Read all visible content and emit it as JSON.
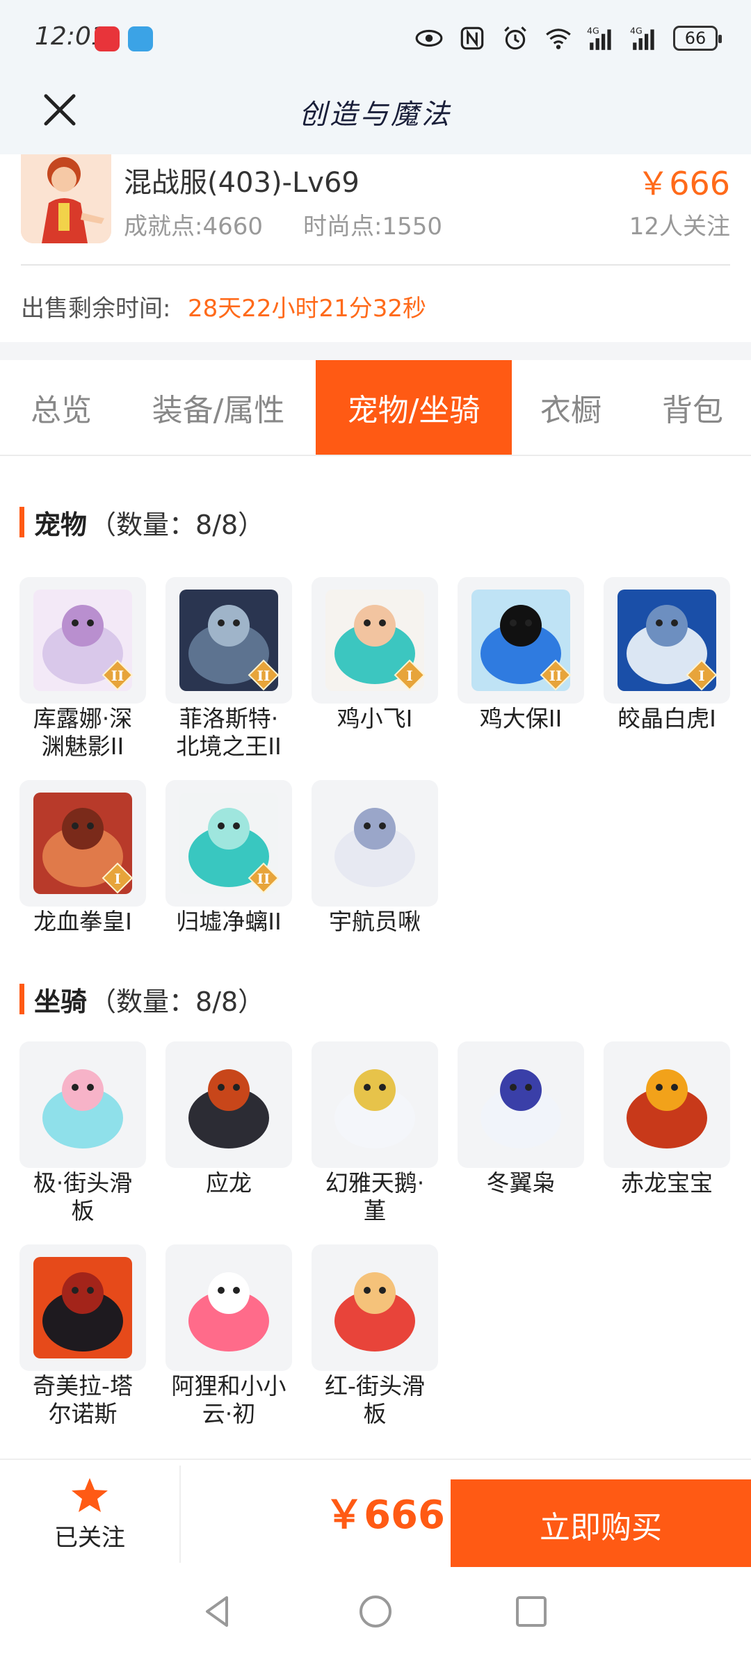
{
  "status_bar": {
    "time": "12:01",
    "battery": "66",
    "network": "4G"
  },
  "header": {
    "title": "创造与魔法"
  },
  "role": {
    "name": "混战服(403)-Lv69",
    "achievement": "成就点:4660",
    "fashion": "时尚点:1550",
    "price": "￥666",
    "followers": "12人关注",
    "sale_label": "出售剩余时间:",
    "sale_remaining": "28天22小时21分32秒"
  },
  "tabs": [
    {
      "label": "总览"
    },
    {
      "label": "装备/属性"
    },
    {
      "label": "宠物/坐骑",
      "active": true
    },
    {
      "label": "衣橱"
    },
    {
      "label": "背包"
    }
  ],
  "pets": {
    "title": "宠物",
    "count": "（数量：8/8）",
    "items": [
      {
        "name": "库露娜·深渊魅影II",
        "line1": "库露娜·深",
        "line2": "渊魅影II",
        "rank": "II",
        "colors": [
          "#f3e9f7",
          "#d9c8ea",
          "#b98fcf"
        ]
      },
      {
        "name": "菲洛斯特·北境之王II",
        "line1": "菲洛斯特·",
        "line2": "北境之王II",
        "rank": "II",
        "colors": [
          "#2a3550",
          "#5d7390",
          "#9fb4c9"
        ]
      },
      {
        "name": "鸡小飞I",
        "line1": "鸡小飞I",
        "line2": "",
        "rank": "I",
        "colors": [
          "#f6f3ef",
          "#3cc6c0",
          "#f2c4a0"
        ]
      },
      {
        "name": "鸡大保II",
        "line1": "鸡大保II",
        "line2": "",
        "rank": "II",
        "colors": [
          "#bfe3f5",
          "#2f7be0",
          "#111111"
        ]
      },
      {
        "name": "皎晶白虎Ⅰ",
        "line1": "皎晶白虎Ⅰ",
        "line2": "",
        "rank": "I",
        "colors": [
          "#1a4fa8",
          "#dbe6f3",
          "#6d8fc0"
        ]
      },
      {
        "name": "龙血拳皇Ⅰ",
        "line1": "龙血拳皇Ⅰ",
        "line2": "",
        "rank": "I",
        "colors": [
          "#b83a2a",
          "#e07a4a",
          "#7a2a1a"
        ]
      },
      {
        "name": "归墟净螭II",
        "line1": "归墟净螭II",
        "line2": "",
        "rank": "II",
        "colors": [
          "#f2f4f5",
          "#39c7c0",
          "#9fe6de"
        ]
      },
      {
        "name": "宇航员啾",
        "line1": "宇航员啾",
        "line2": "",
        "rank": "",
        "colors": [
          "#f3f4f6",
          "#e7e9f2",
          "#9aa6c9"
        ]
      }
    ]
  },
  "mounts": {
    "title": "坐骑",
    "count": "（数量：8/8）",
    "items": [
      {
        "name": "极·街头滑板",
        "line1": "极·街头滑",
        "line2": "板",
        "colors": [
          "#f3f4f6",
          "#8fe0ea",
          "#f7b3c8"
        ]
      },
      {
        "name": "应龙",
        "line1": "应龙",
        "line2": "",
        "colors": [
          "#f3f4f6",
          "#2c2c34",
          "#c8461a"
        ]
      },
      {
        "name": "幻雅天鹅·堇",
        "line1": "幻雅天鹅·",
        "line2": "堇",
        "colors": [
          "#f3f4f6",
          "#f4f6fa",
          "#e7c34a"
        ]
      },
      {
        "name": "冬翼枭",
        "line1": "冬翼枭",
        "line2": "",
        "colors": [
          "#f3f4f6",
          "#f1f4fa",
          "#3a3fa8"
        ]
      },
      {
        "name": "赤龙宝宝",
        "line1": "赤龙宝宝",
        "line2": "",
        "colors": [
          "#f3f4f6",
          "#c8391a",
          "#f2a21a"
        ]
      },
      {
        "name": "奇美拉-塔尔诺斯",
        "line1": "奇美拉-塔",
        "line2": "尔诺斯",
        "colors": [
          "#e64a1a",
          "#1e1a1f",
          "#a3241a"
        ]
      },
      {
        "name": "阿狸和小小云·初",
        "line1": "阿狸和小小",
        "line2": "云·初",
        "colors": [
          "#f3f4f6",
          "#ff6b8a",
          "#ffffff"
        ]
      },
      {
        "name": "红-街头滑板",
        "line1": "红-街头滑",
        "line2": "板",
        "colors": [
          "#f3f4f6",
          "#e8443a",
          "#f5c27a"
        ]
      }
    ]
  },
  "bottom": {
    "follow_label": "已关注",
    "price": "￥666",
    "buy_label": "立即购买"
  },
  "theme": {
    "accent": "#ff5a14",
    "price": "#ff6a1a"
  }
}
